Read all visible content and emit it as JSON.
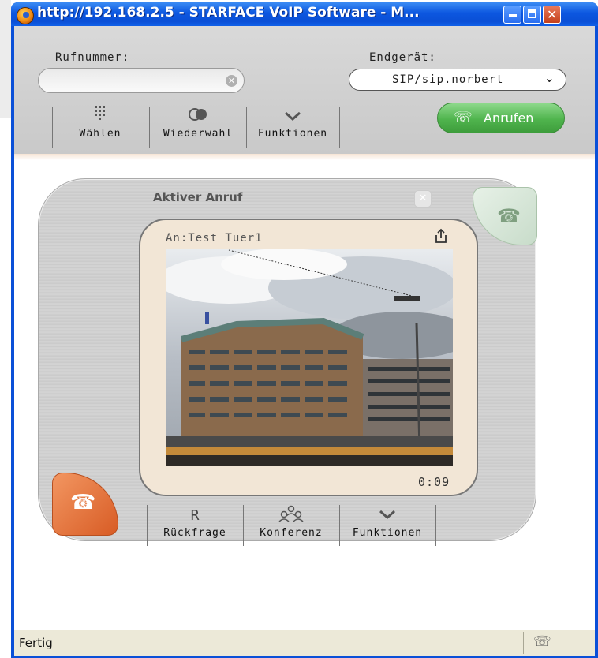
{
  "window": {
    "title": "http://192.168.2.5 - STARFACE VoIP Software - M...",
    "controls": {
      "minimize": "_",
      "maximize": "□",
      "close": "✕"
    }
  },
  "toolbar": {
    "phone_label": "Rufnummer:",
    "phone_value": "",
    "device_label": "Endgerät:",
    "device_value": "SIP/sip.norbert",
    "buttons": [
      {
        "label": "Wählen",
        "icon": "dialpad-icon"
      },
      {
        "label": "Wiederwahl",
        "icon": "redial-icon"
      },
      {
        "label": "Funktionen",
        "icon": "chevron-down-icon"
      }
    ],
    "call_button": "Anrufen"
  },
  "call_panel": {
    "title": "Aktiver Anruf",
    "callee": "An:Test Tuer1",
    "duration": "0:09",
    "buttons": [
      {
        "label": "Rückfrage",
        "icon": "R"
      },
      {
        "label": "Konferenz",
        "icon": "conference-icon"
      },
      {
        "label": "Funktionen",
        "icon": "chevron-down-icon"
      }
    ]
  },
  "status_bar": {
    "text": "Fertig"
  },
  "colors": {
    "accent_green": "#4fb44d",
    "hangup_orange": "#e06a30",
    "panel_beige": "#f2e6d6",
    "title_blue": "#0a50d8"
  }
}
